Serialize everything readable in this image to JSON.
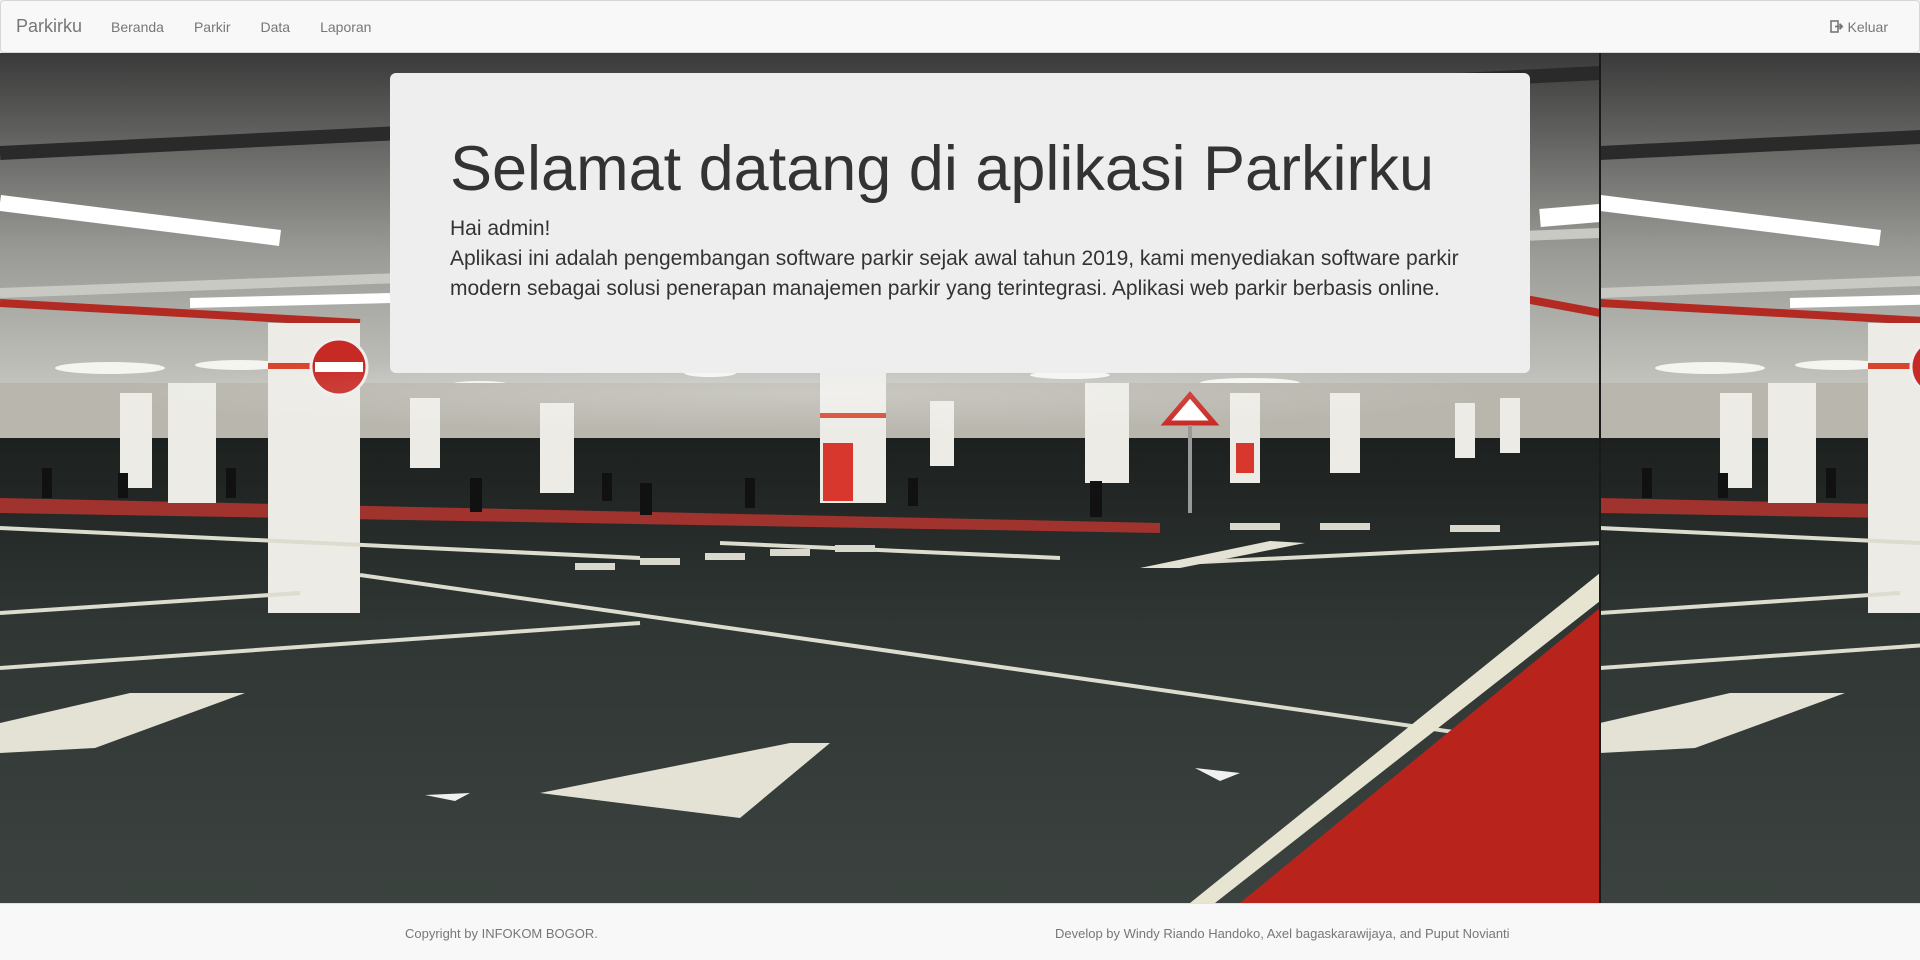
{
  "navbar": {
    "brand": "Parkirku",
    "items": [
      {
        "label": "Beranda"
      },
      {
        "label": "Parkir"
      },
      {
        "label": "Data"
      },
      {
        "label": "Laporan"
      }
    ],
    "logout": {
      "label": "Keluar",
      "icon": "logout-icon"
    }
  },
  "jumbotron": {
    "title": "Selamat datang di aplikasi Parkirku",
    "greeting": "Hai admin!",
    "description": "Aplikasi ini adalah pengembangan software parkir sejak awal tahun 2019, kami menyediakan software parkir modern sebagai solusi penerapan manajemen parkir yang terintegrasi. Aplikasi web parkir berbasis online."
  },
  "footer": {
    "copyright": "Copyright by INFOKOM BOGOR.",
    "developers": "Develop by Windy Riando Handoko, Axel bagaskarawijaya, and Puput Novianti"
  },
  "colors": {
    "navbar_bg": "#f8f8f8",
    "jumbotron_bg": "#eeeeee",
    "text": "#333333",
    "muted": "#777777",
    "asphalt": "#2f3532",
    "red_lane": "#c0231b"
  }
}
